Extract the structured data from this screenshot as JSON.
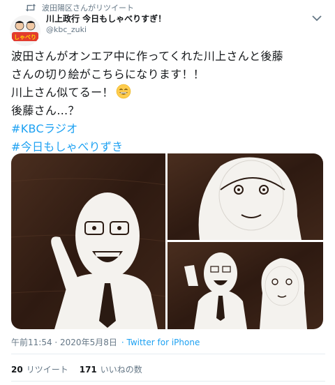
{
  "retweet": {
    "label": "波田陽区さんがリツイート",
    "icon": "retweet-icon"
  },
  "author": {
    "name": "川上政行 今日もしゃべりすぎ！",
    "handle": "@kbc_zuki",
    "avatar_text": "しゃべり"
  },
  "tweet": {
    "lines": [
      "波田さんがオンエア中に作ってくれた川上さんと後藤",
      "さんの切り絵がこちらになります！！",
      "川上さん似てるー！",
      "後藤さん…？"
    ],
    "emoji": "grinning-face-emoji",
    "hashtags": [
      "#KBCラジオ",
      "#今日もしゃべりずき"
    ]
  },
  "timestamp": "午前11:54 · 2020年5月8日",
  "via": "· Twitter for iPhone",
  "stats": {
    "retweets": "20",
    "retweets_label": "リツイート",
    "likes": "171",
    "likes_label": "いいねの数"
  },
  "colors": {
    "link": "#1da1f2",
    "secondary": "#657786",
    "text": "#14171a",
    "wood": "#3a2418"
  }
}
